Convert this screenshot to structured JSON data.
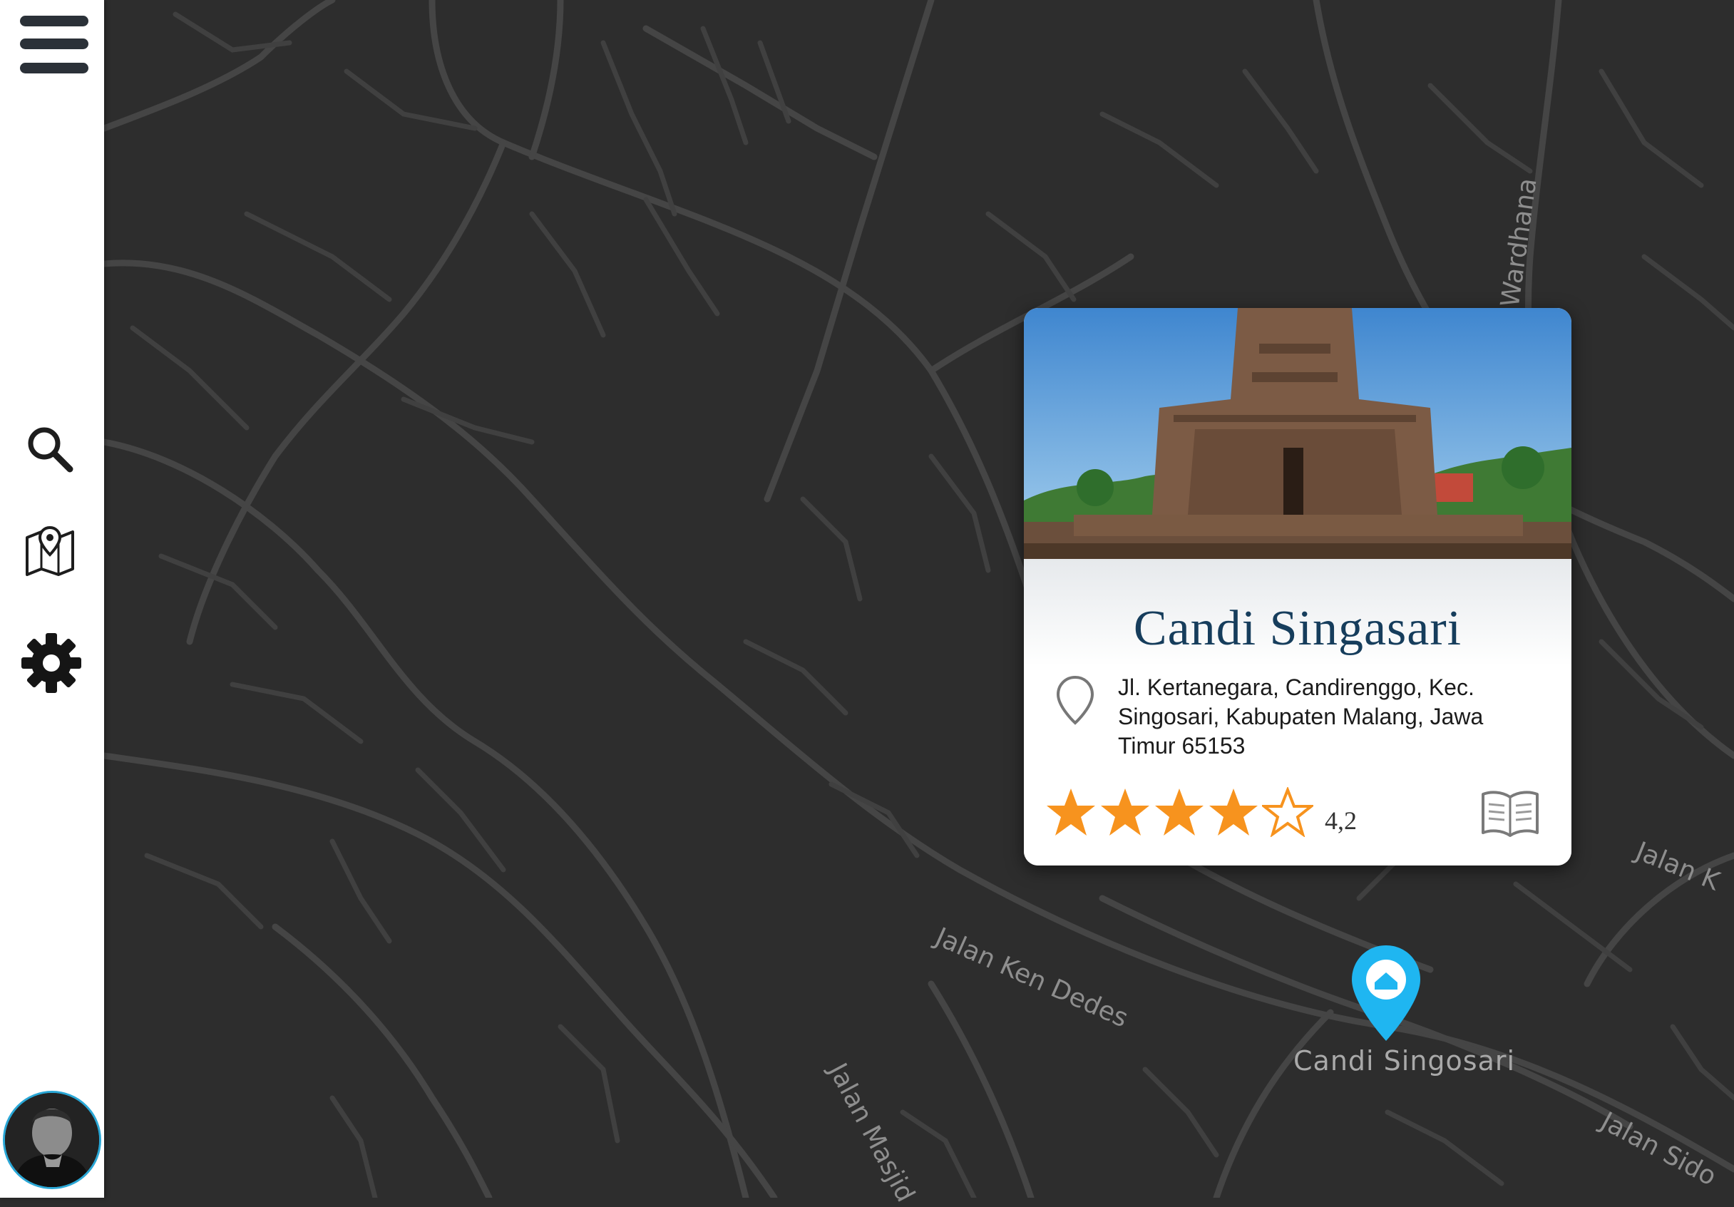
{
  "sidebar": {
    "menu_icon": "hamburger-menu-icon",
    "items": [
      {
        "id": "search",
        "icon": "search-icon"
      },
      {
        "id": "map",
        "icon": "folded-map-pin-icon"
      },
      {
        "id": "settings",
        "icon": "gear-icon"
      }
    ],
    "avatar": "user-avatar"
  },
  "map": {
    "theme": "dark",
    "roads": [
      "Wardhana",
      "Jalan Ken Dedes",
      "Jalan Masjid",
      "Jalan Sido",
      "Jalan K"
    ],
    "marker": {
      "label": "Candi Singosari",
      "color": "#1fb6f1"
    }
  },
  "place_card": {
    "title": "Candi Singasari",
    "address": "Jl. Kertanegara, Candirenggo, Kec. Singosari, Kabupaten Malang, Jawa Timur 65153",
    "rating": {
      "stars_filled": 4,
      "stars_total": 5,
      "value": "4,2",
      "color": "#f7931e"
    },
    "photo": "temple-photo",
    "guide_icon": "open-book-icon"
  }
}
